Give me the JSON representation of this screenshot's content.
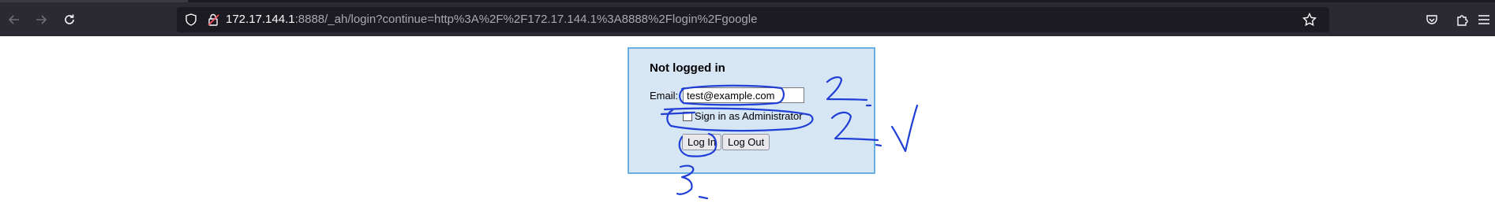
{
  "browser": {
    "url_host": "172.17.144.1",
    "url_rest": ":8888/_ah/login?continue=http%3A%2F%2F172.17.144.1%3A8888%2Flogin%2Fgoogle"
  },
  "login": {
    "title": "Not logged in",
    "email_label": "Email:",
    "email_value": "test@example.com",
    "admin_label": "Sign in as Administrator",
    "login_button": "Log In",
    "logout_button": "Log Out"
  },
  "colors": {
    "toolbar": "#2b2a33",
    "urlbar": "#1c1b22",
    "login_box_bg": "#d7e6f5",
    "login_box_border": "#6aaee2",
    "annotation_ink": "#1f3fd6"
  }
}
